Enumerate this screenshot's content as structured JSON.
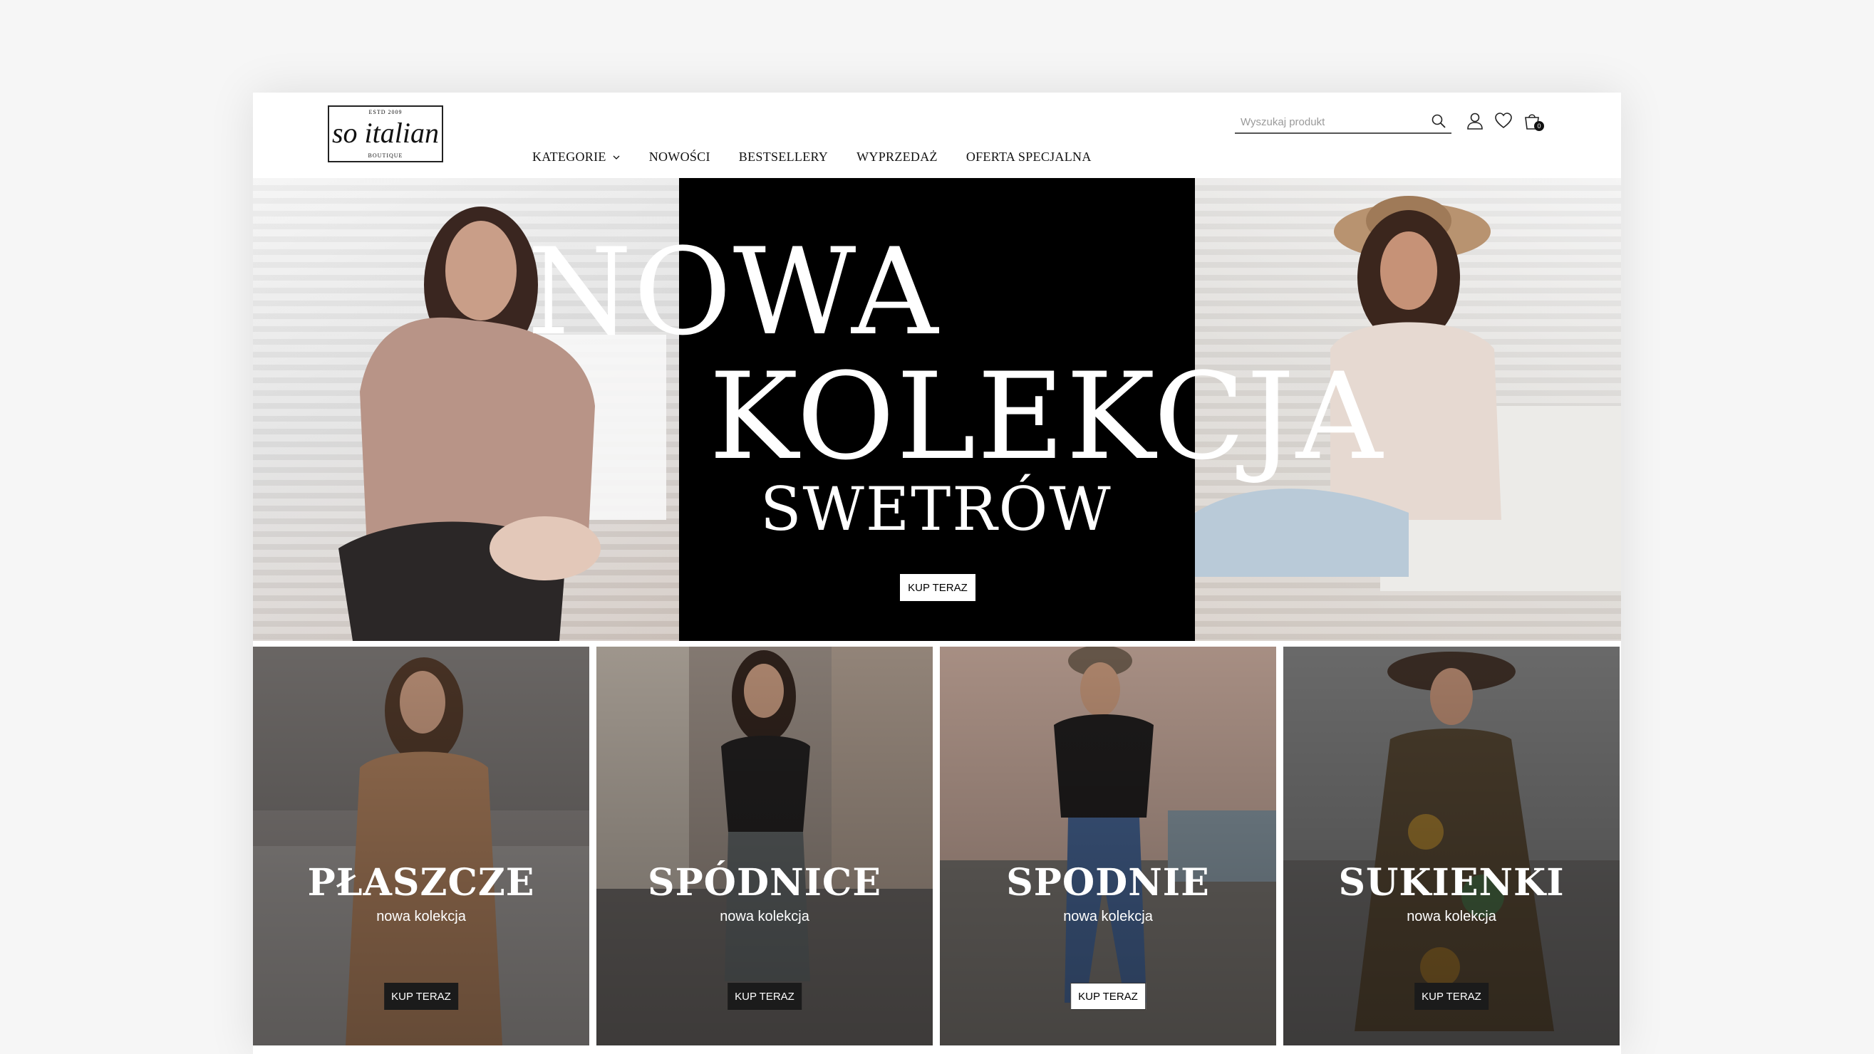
{
  "logo": {
    "estd": "ESTD 2009",
    "name": "so italian",
    "sub": "BOUTIQUE"
  },
  "nav": [
    {
      "label": "KATEGORIE"
    },
    {
      "label": "NOWOŚCI"
    },
    {
      "label": "BESTSELLERY"
    },
    {
      "label": "WYPRZEDAŻ"
    },
    {
      "label": "OFERTA SPECJALNA"
    }
  ],
  "search": {
    "placeholder": "Wyszukaj produkt",
    "value": ""
  },
  "cart": {
    "count": "0"
  },
  "hero": {
    "title_line1": "NOWA",
    "title_line2": "KOLEKCJA",
    "subtitle": "SWETRÓW",
    "button": "KUP TERAZ"
  },
  "categories": [
    {
      "title": "PŁASZCZE",
      "subtitle": "nowa kolekcja",
      "button": "KUP TERAZ"
    },
    {
      "title": "SPÓDNICE",
      "subtitle": "nowa kolekcja",
      "button": "KUP TERAZ"
    },
    {
      "title": "SPODNIE",
      "subtitle": "nowa kolekcja",
      "button": "KUP TERAZ"
    },
    {
      "title": "SUKIENKI",
      "subtitle": "nowa kolekcja",
      "button": "KUP TERAZ"
    }
  ],
  "colors": {
    "page_bg": "#f6f6f6",
    "hero_center": "#000000",
    "text_dark": "#111111"
  },
  "icons": [
    "search-icon",
    "user-icon",
    "heart-icon",
    "bag-icon",
    "chevron-down-icon"
  ]
}
